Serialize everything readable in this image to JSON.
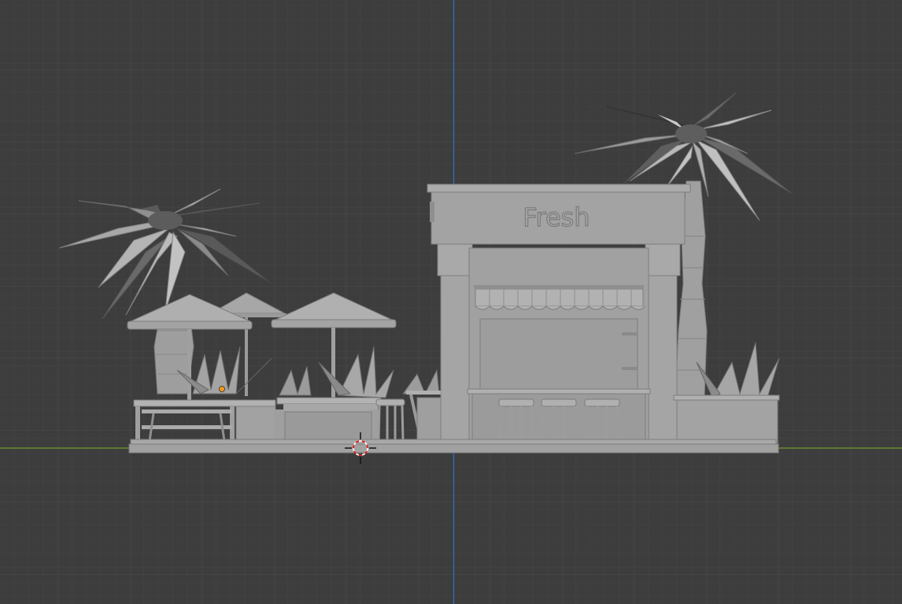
{
  "viewport": {
    "view": "front-orthographic",
    "background_color": "#3d3d3d",
    "x_axis_color": "#6f9b2e",
    "z_axis_color": "#2f6fd0",
    "mesh_color": "#a9a9a9",
    "selected_origin_color": "#f29a1c"
  },
  "scene": {
    "kiosk_sign": "Fresh",
    "objects": [
      "palm-tree-left",
      "palm-tree-right",
      "umbrella-1",
      "umbrella-2",
      "umbrella-3",
      "kiosk",
      "stool-1",
      "stool-2",
      "stool-3",
      "stool-4",
      "agave-plants",
      "planter-right",
      "picnic-tables",
      "ground-base"
    ]
  },
  "cursor": {
    "icon": "3d-cursor-icon"
  }
}
